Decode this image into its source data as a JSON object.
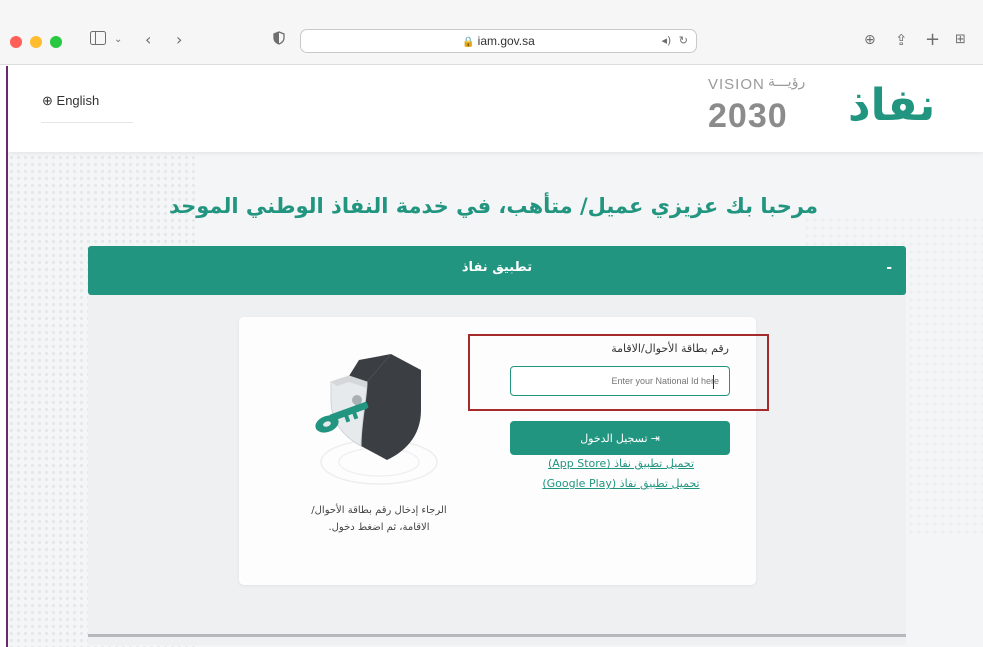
{
  "browser": {
    "url": "iam.gov.sa",
    "icons": [
      "sidebar-icon",
      "chevron-down-icon",
      "back-icon",
      "forward-icon",
      "shield-icon",
      "lock-icon",
      "audio-icon",
      "reload-icon",
      "download-icon",
      "share-icon",
      "new-tab-icon",
      "tab-overview-icon"
    ]
  },
  "header": {
    "language_link": "English",
    "vision_text": "VISION",
    "vision_arabic": "رؤيـــة",
    "vision_year": "2030",
    "logo_text": "نفاذ"
  },
  "main": {
    "welcome_title": "مرحبا بك عزيزي عميل/ متأهب، في خدمة النفاذ الوطني الموحد",
    "panel_title": "تطبيق نفاذ",
    "panel_collapse": "-"
  },
  "login": {
    "id_label": "رقم بطاقة الأحوال/الاقامة",
    "id_placeholder": "Enter your National Id here",
    "id_value": "",
    "login_button": "تسجيل الدخول",
    "app_store_link": "تحميل تطبيق نفاذ (App Store)",
    "google_play_link": "تحميل تطبيق نفاذ (Google Play)",
    "hint_line1": "الرجاء إدخال رقم بطاقة الأحوال/",
    "hint_line2": "الاقامة، ثم اضغط دخول."
  },
  "colors": {
    "brand": "#21957f",
    "highlight": "#a52a2a"
  }
}
